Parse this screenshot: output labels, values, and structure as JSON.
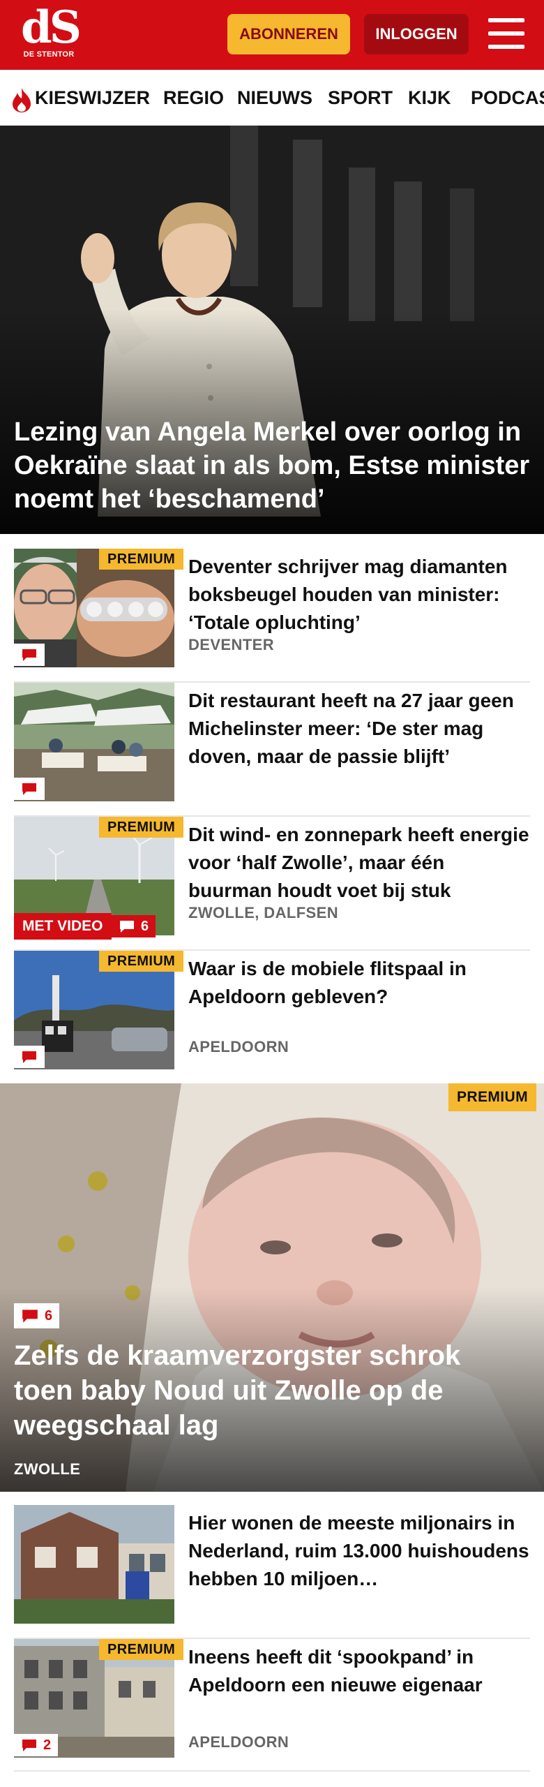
{
  "header": {
    "logo_text": "dS",
    "logo_subtitle": "DE STENTOR",
    "subscribe_label": "ABONNEREN",
    "login_label": "INLOGGEN",
    "menu_icon": "hamburger-icon",
    "brand_color": "#d30d14",
    "accent_color": "#f5b82e"
  },
  "nav": {
    "items": [
      {
        "label": "KIESWIJZER",
        "icon": "flame-icon"
      },
      {
        "label": "REGIO"
      },
      {
        "label": "NIEUWS"
      },
      {
        "label": "SPORT"
      },
      {
        "label": "KIJK"
      },
      {
        "label": "PODCAS"
      }
    ]
  },
  "hero": {
    "title": "Lezing van Angela Merkel over oorlog in Oekraïne slaat in als bom, Estse minister noemt het ‘beschamend’"
  },
  "articles": [
    {
      "title": "Deventer schrijver mag diamanten boksbeugel houden van minister: ‘Totale opluchting’",
      "tag": "DEVENTER",
      "premium": "PREMIUM",
      "comment_count": ""
    },
    {
      "title": "Dit restaurant heeft na 27 jaar geen Michelinster meer: ‘De ster mag doven, maar de passie blijft’",
      "tag": "",
      "premium": "",
      "comment_count": ""
    },
    {
      "title": "Dit wind- en zonnepark heeft energie voor ‘half Zwolle’, maar één buurman houdt voet bij stuk",
      "tag": "ZWOLLE, DALFSEN",
      "premium": "PREMIUM",
      "video": "MET VIDEO",
      "comment_count": "6"
    },
    {
      "title": "Waar is de mobiele flitspaal in Apeldoorn gebleven?",
      "tag": "APELDOORN",
      "premium": "PREMIUM",
      "comment_count": ""
    }
  ],
  "feature": {
    "premium": "PREMIUM",
    "comment_count": "6",
    "title": "Zelfs de kraamverzorgster schrok toen baby Noud uit Zwolle op de weegschaal lag",
    "tag": "ZWOLLE"
  },
  "articles_bottom": [
    {
      "title": "Hier wonen de meeste miljonairs in Nederland, ruim 13.000 huishoudens hebben 10 miljoen…",
      "tag": "",
      "premium": "",
      "comment_count": ""
    },
    {
      "title": "Ineens heeft dit ‘spookpand’ in Apeldoorn een nieuwe eigenaar",
      "tag": "APELDOORN",
      "premium": "PREMIUM",
      "comment_count": "2"
    }
  ]
}
